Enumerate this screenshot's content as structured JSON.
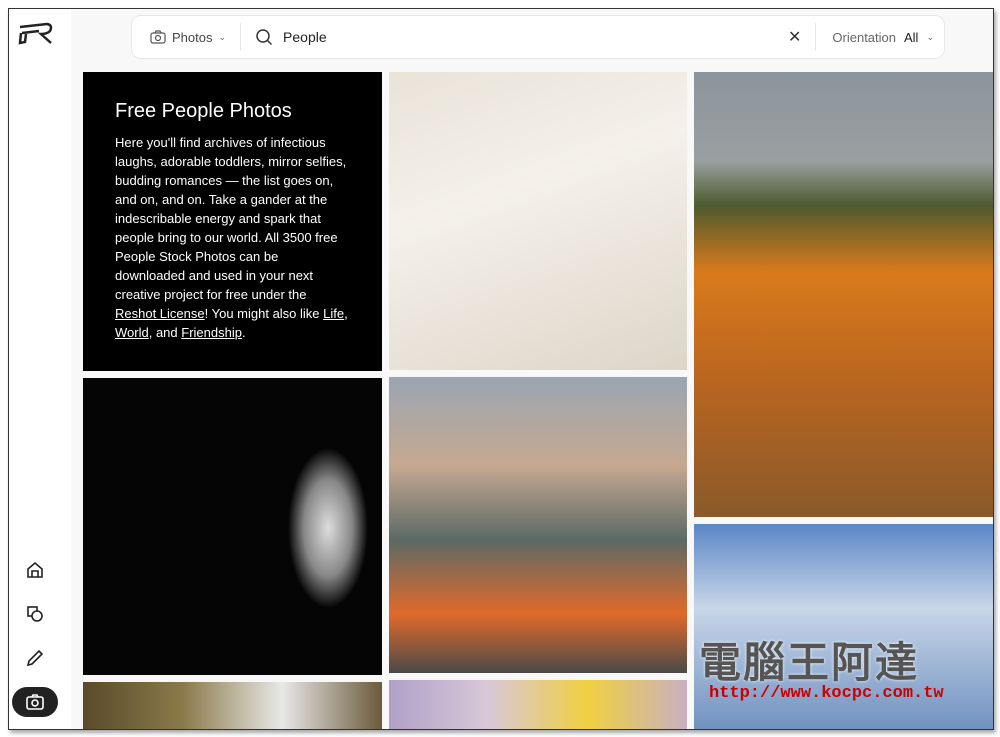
{
  "search": {
    "type_label": "Photos",
    "query": "People",
    "orientation_label": "Orientation",
    "orientation_value": "All"
  },
  "intro": {
    "title": "Free People Photos",
    "text_1": "Here you'll find archives of infectious laughs, adorable toddlers, mirror selfies, budding romances — the list goes on, and on, and on. Take a gander at the indescribable energy and spark that people bring to our world. All 3500 free People Stock Photos can be downloaded and used in your next creative project for free under the ",
    "license_link": "Reshot License",
    "text_2": "! You might also like ",
    "link_life": "Life",
    "sep1": ", ",
    "link_world": "World",
    "sep2": ", and ",
    "link_friendship": "Friendship",
    "end": "."
  },
  "sidebar": {
    "items": [
      "home",
      "shapes",
      "edit",
      "photos"
    ],
    "active": "photos"
  },
  "photos": [
    {
      "subject": "white stairs architecture"
    },
    {
      "subject": "man and child in pumpkin field"
    },
    {
      "subject": "woman with striped hat in spotlight"
    },
    {
      "subject": "watchmaker repairing watches"
    },
    {
      "subject": "sky with clouds"
    },
    {
      "subject": "older man portrait"
    },
    {
      "subject": "street scene"
    }
  ],
  "watermark": {
    "text": "電腦王阿達",
    "url": "http://www.kocpc.com.tw"
  }
}
